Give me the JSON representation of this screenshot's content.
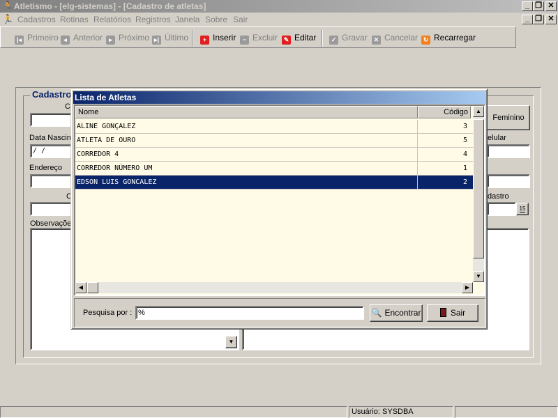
{
  "window": {
    "title": "Atletismo - [elg-sistemas] - [Cadastro de atletas]"
  },
  "menu": [
    "Cadastros",
    "Rotinas",
    "Relatórios",
    "Registros",
    "Janela",
    "Sobre",
    "Sair"
  ],
  "toolbar": {
    "first": "Primeiro",
    "previous": "Anterior",
    "next": "Próximo",
    "last": "Último",
    "insert": "Inserir",
    "delete": "Excluir",
    "edit": "Editar",
    "save": "Gravar",
    "cancel": "Cancelar",
    "reload": "Recarregar"
  },
  "form": {
    "group_title": "Cadastro",
    "label_c": "C",
    "female_button": "Feminino",
    "birth_label": "Data Nascin",
    "birth_value": " / /",
    "cell_label": "elular",
    "address_label": "Endereço",
    "label_c2": "C",
    "registration_label": "dastro",
    "calendar_button": "15",
    "notes_label": "Observaçõe"
  },
  "dialog": {
    "title": "Lista de Atletas",
    "columns": [
      "Nome",
      "Código"
    ],
    "rows": [
      {
        "name": "ALINE GONÇALEZ",
        "code": "3"
      },
      {
        "name": "ATLETA DE OURO",
        "code": "5"
      },
      {
        "name": "CORREDOR 4",
        "code": "4"
      },
      {
        "name": "CORREDOR NÚMERO UM",
        "code": "1"
      },
      {
        "name": "EDSON LUIS GONCALEZ",
        "code": "2"
      }
    ],
    "search_label": "Pesquisa por :",
    "search_value": "%",
    "find_button": "Encontrar",
    "exit_button": "Sair"
  },
  "status": {
    "user": "Usuário: SYSDBA"
  }
}
